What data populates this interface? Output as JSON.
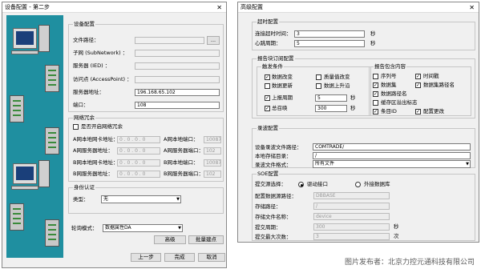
{
  "left_window": {
    "title": "设备配置 - 第二步",
    "device_config": {
      "title": "设备配置",
      "file_path_label": "文件路径：",
      "browse_label": "...",
      "subnet_label": "子网 (SubNetwork) ：",
      "server_ied_label": "服务器 (IED) ：",
      "access_point_label": "访问点 (AccessPoint) ：",
      "server_address_label": "服务器地址：",
      "server_address_value": "196.168.65.102",
      "port_label": "端口：",
      "port_value": "108"
    },
    "network_redundancy": {
      "title": "网络冗余",
      "enable_label": "是否开启网络冗余",
      "a_local_addr_label": "A网本地网卡地址：",
      "a_local_addr_value": "0 . 0 . 0 . 0",
      "a_local_port_label": "A网本地端口：",
      "a_local_port_value": "10087",
      "a_server_addr_label": "A网服务器地址：",
      "a_server_addr_value": "0 . 0 . 0 . 0",
      "a_server_port_label": "A网服务器端口：",
      "a_server_port_value": "102",
      "b_local_addr_label": "B网本地网卡地址：",
      "b_local_addr_value": "0 . 0 . 0 . 0",
      "b_local_port_label": "B网本地端口：",
      "b_local_port_value": "10087",
      "b_server_addr_label": "B网服务器地址：",
      "b_server_addr_value": "0 . 0 . 0 . 0",
      "b_server_port_label": "B网服务器端口：",
      "b_server_port_value": "102"
    },
    "authentication": {
      "title": "身份认证",
      "type_label": "类型：",
      "type_value": "无"
    },
    "polling_mode_label": "轮询模式：",
    "polling_mode_value": "数据属性DA",
    "advanced_button": "高级",
    "batch_points_button": "批量建点",
    "prev_button": "上一步",
    "finish_button": "完成",
    "cancel_button": "取消"
  },
  "right_window": {
    "title": "高级配置",
    "timeout": {
      "title": "超时配置",
      "connect_timeout_label": "连接超时时间：",
      "connect_timeout_value": "3",
      "heartbeat_label": "心跳周期：",
      "heartbeat_value": "5",
      "unit_seconds": "秒"
    },
    "report_block": {
      "title": "报告块订阅配置",
      "trigger_title": "触发条件",
      "trigger_items": [
        "数据改变",
        "质量值改变",
        "数据更新",
        "数据上升沿"
      ],
      "trigger_checked": [
        true,
        false,
        false,
        false
      ],
      "upload_period_label": "上报周期",
      "upload_period_checked": true,
      "upload_period_value": "5",
      "total_call_label": "总召唤",
      "total_call_checked": true,
      "total_call_value": "300",
      "unit_seconds": "秒",
      "content_title": "报告包含内容",
      "content_items": [
        "序列号",
        "时间戳",
        "数据集",
        "数据集路径名",
        "数据路径名",
        "缓存区溢出标志",
        "条目ID",
        "配置更改"
      ],
      "content_checked": [
        false,
        true,
        true,
        true,
        true,
        false,
        true,
        true
      ]
    },
    "recording": {
      "title": "录波配置",
      "device_path_label": "设备录波文件路径：",
      "device_path_value": "COMTRADE/",
      "local_dir_label": "本地存储目录：",
      "local_dir_value": "/",
      "file_format_label": "录波文件格式：",
      "file_format_value": "所有文件"
    },
    "soe": {
      "title": "SOE配置",
      "submit_mode_label": "提交源选择：",
      "option_driver": "驱动接口",
      "option_external_db": "外接数据库",
      "db_source_label": "配置数据源路径：",
      "db_source_value": "DBBASE",
      "storage_path_label": "存储路径：",
      "storage_path_value": "/",
      "storage_file_label": "存储文件名称：",
      "storage_file_value": "device",
      "submit_period_label": "提交周期：",
      "submit_period_value": "300",
      "submit_period_unit": "秒",
      "max_submit_label": "提交最大次数：",
      "max_submit_value": "3",
      "max_submit_unit": "次"
    }
  },
  "watermark": "图片发布者：北京力控元通科技有限公司"
}
